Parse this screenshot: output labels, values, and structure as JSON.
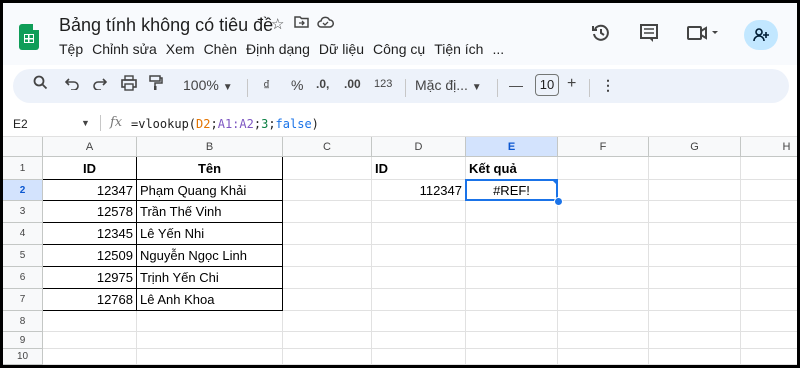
{
  "app": {
    "doc_title": "Bảng tính không có tiêu đề",
    "menu": [
      "Tệp",
      "Chỉnh sửa",
      "Xem",
      "Chèn",
      "Định dạng",
      "Dữ liệu",
      "Công cụ",
      "Tiện ích",
      "..."
    ]
  },
  "toolbar": {
    "zoom": "100%",
    "currency": "₫",
    "percent": "%",
    "dec_decrease": ".0,",
    "dec_increase": ".00",
    "number_format": "123",
    "font": "Mặc đị...",
    "font_size": "10",
    "minus": "—",
    "plus": "+"
  },
  "formula_bar": {
    "name_box": "E2",
    "fx": "fx",
    "formula": [
      {
        "text": "=vlookup(",
        "color": "#1f1f1f"
      },
      {
        "text": "D2",
        "color": "#e37400"
      },
      {
        "text": ";",
        "color": "#1f1f1f"
      },
      {
        "text": "A1:A2",
        "color": "#7e57c2"
      },
      {
        "text": ";",
        "color": "#1f1f1f"
      },
      {
        "text": "3",
        "color": "#0b8043"
      },
      {
        "text": ";",
        "color": "#1f1f1f"
      },
      {
        "text": "false",
        "color": "#1a73e8"
      },
      {
        "text": ")",
        "color": "#1f1f1f"
      }
    ]
  },
  "sheet": {
    "columns": [
      "A",
      "B",
      "C",
      "D",
      "E",
      "F",
      "G",
      "H"
    ],
    "selected_column": "E",
    "rows": [
      "1",
      "2",
      "3",
      "4",
      "5",
      "6",
      "7",
      "8",
      "9",
      "10"
    ],
    "selected_row": "2",
    "header_id": "ID",
    "header_name": "Tên",
    "data": [
      {
        "id": "12347",
        "name": "Phạm Quang Khải"
      },
      {
        "id": "12578",
        "name": "Trần Thế Vinh"
      },
      {
        "id": "12345",
        "name": "Lê Yến Nhi"
      },
      {
        "id": "12509",
        "name": "Nguyễn Ngọc Linh"
      },
      {
        "id": "12975",
        "name": "Trịnh Yến Chi"
      },
      {
        "id": "12768",
        "name": "Lê Anh Khoa"
      }
    ],
    "d1": "ID",
    "e1": "Kết quả",
    "d2": "112347",
    "e2": "#REF!",
    "selection_color": "#1a73e8"
  }
}
